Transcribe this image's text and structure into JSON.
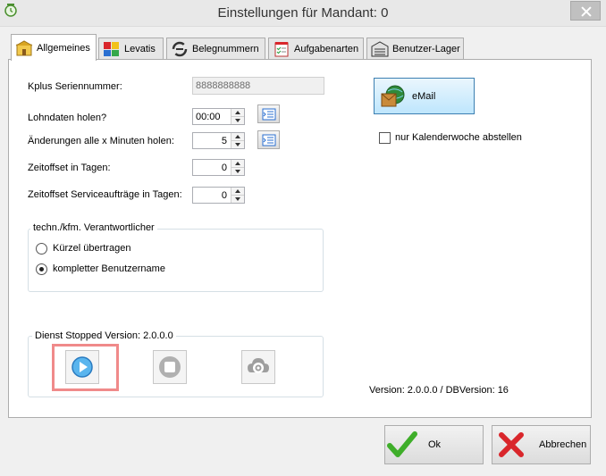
{
  "window": {
    "title": "Einstellungen für Mandant: 0",
    "app_icon": "clock-icon"
  },
  "tabs": [
    {
      "label": "Allgemeines",
      "icon": "house-icon",
      "active": true
    },
    {
      "label": "Levatis",
      "icon": "puzzle-icon",
      "active": false
    },
    {
      "label": "Belegnummern",
      "icon": "cycle-icon",
      "active": false
    },
    {
      "label": "Aufgabenarten",
      "icon": "checklist-icon",
      "active": false
    },
    {
      "label": "Benutzer-Lager",
      "icon": "warehouse-icon",
      "active": false
    }
  ],
  "general": {
    "serial_label": "Kplus Seriennummer:",
    "serial_value": "8888888888",
    "lohn_label": "Lohndaten holen?",
    "lohn_value": "00:00",
    "changes_label": "Änderungen alle x Minuten holen:",
    "changes_value": "5",
    "offset_label": "Zeitoffset in Tagen:",
    "offset_value": "0",
    "service_offset_label": "Zeitoffset Serviceaufträge in Tagen:",
    "service_offset_value": "0"
  },
  "responsible": {
    "title": "techn./kfm. Verantwortlicher",
    "options": [
      {
        "label": "Kürzel übertragen",
        "selected": false
      },
      {
        "label": "kompletter Benutzername",
        "selected": true
      }
    ]
  },
  "service": {
    "title": "Dienst Stopped Version: 2.0.0.0",
    "buttons": [
      "play-icon",
      "stop-icon",
      "settings-gear-icon"
    ]
  },
  "email": {
    "button_label": "eMail",
    "calendar_week_label": "nur Kalenderwoche abstellen",
    "calendar_week_checked": false
  },
  "version_text": "Version: 2.0.0.0 / DBVersion: 16",
  "footer": {
    "ok_label": "Ok",
    "cancel_label": "Abbrechen"
  },
  "colors": {
    "highlight": "#f08a8a",
    "email_button": "#bee6fd",
    "ok_check": "#3fae2a",
    "cancel_x": "#d9262b"
  }
}
